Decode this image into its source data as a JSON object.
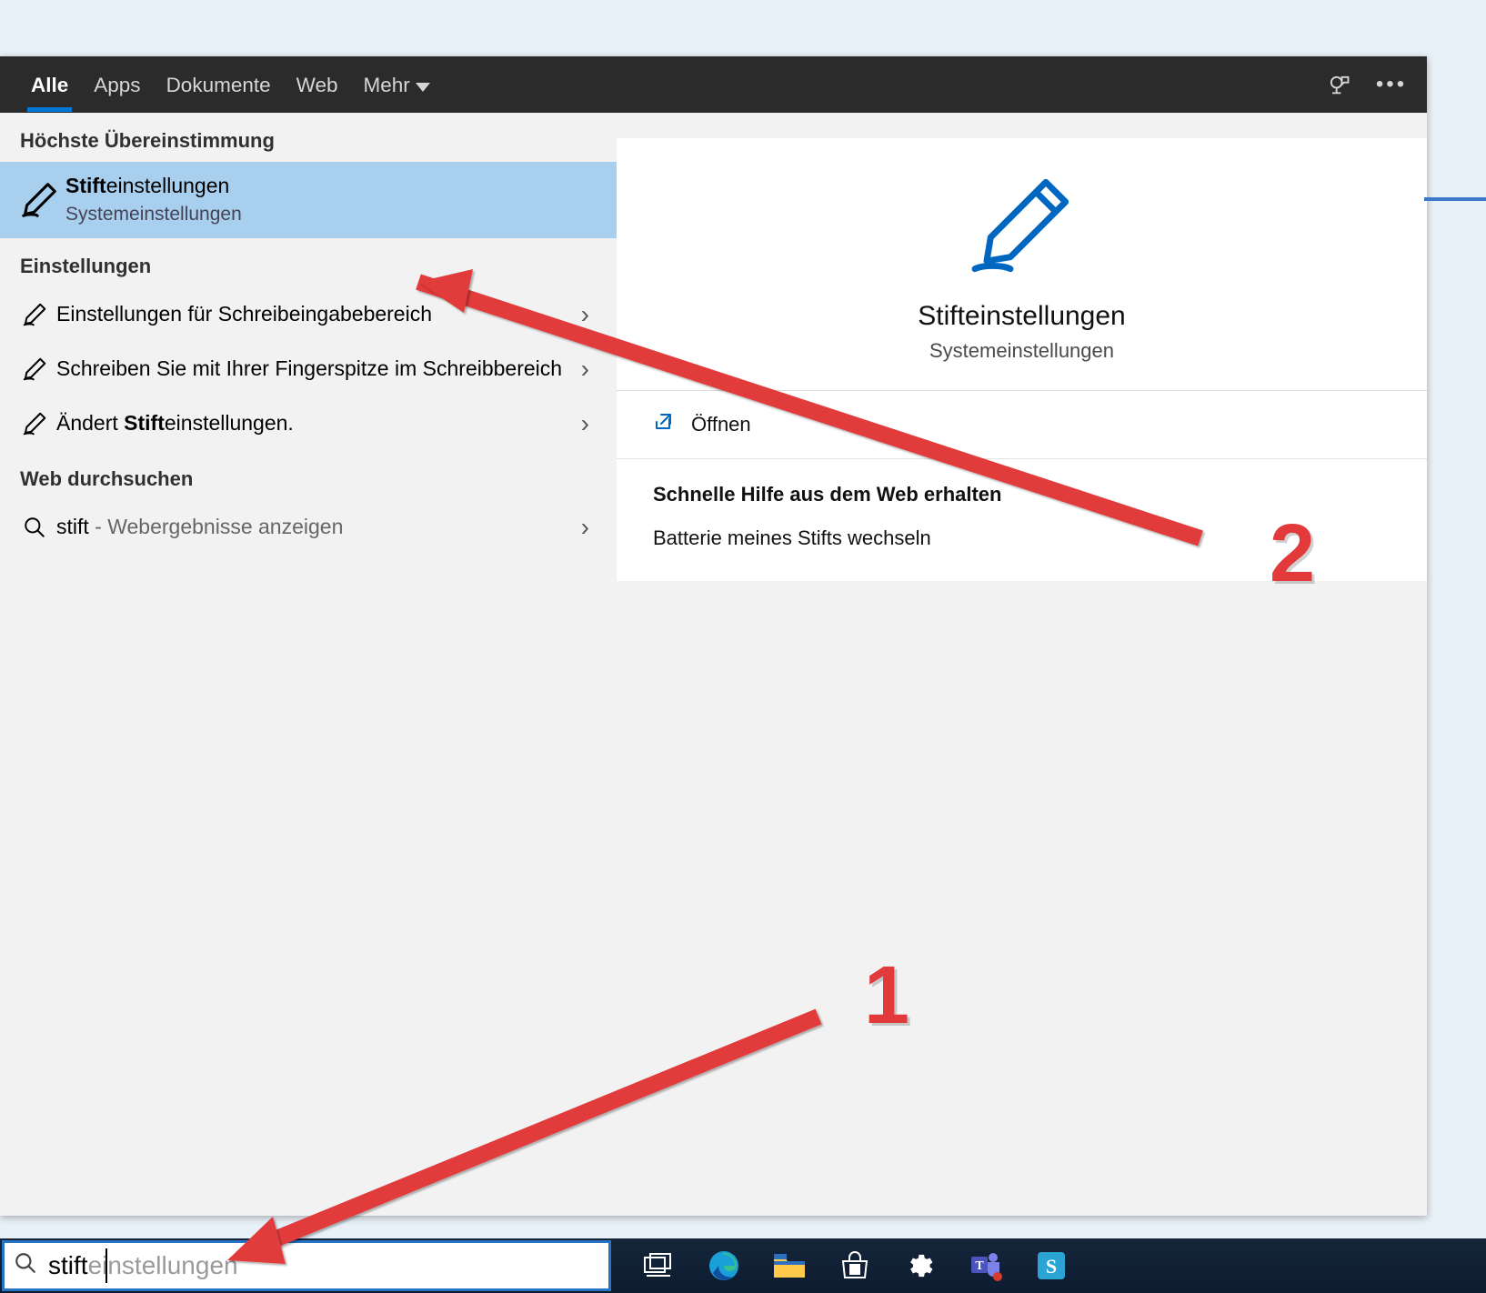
{
  "tabs": {
    "all": "Alle",
    "apps": "Apps",
    "documents": "Dokumente",
    "web": "Web",
    "more": "Mehr"
  },
  "sections": {
    "bestMatch": "Höchste Übereinstimmung",
    "settings": "Einstellungen",
    "webSearch": "Web durchsuchen"
  },
  "bestMatch": {
    "title_bold": "Stift",
    "title_rest": "einstellungen",
    "subtitle": "Systemeinstellungen"
  },
  "settingsItems": [
    {
      "text": "Einstellungen für Schreibeingabebereich"
    },
    {
      "text": "Schreiben Sie mit Ihrer Fingerspitze im Schreibbereich"
    },
    {
      "prefix": "Ändert ",
      "bold": "Stift",
      "suffix": "einstellungen."
    }
  ],
  "webItem": {
    "query": "stift",
    "hint": " - Webergebnisse anzeigen"
  },
  "detail": {
    "title": "Stifteinstellungen",
    "subtitle": "Systemeinstellungen",
    "open": "Öffnen",
    "helpTitle": "Schnelle Hilfe aus dem Web erhalten",
    "helpLink": "Batterie meines Stifts wechseln"
  },
  "searchBox": {
    "typed": "stift",
    "completion": "einstellungen"
  },
  "annotations": {
    "n1": "1",
    "n2": "2"
  }
}
